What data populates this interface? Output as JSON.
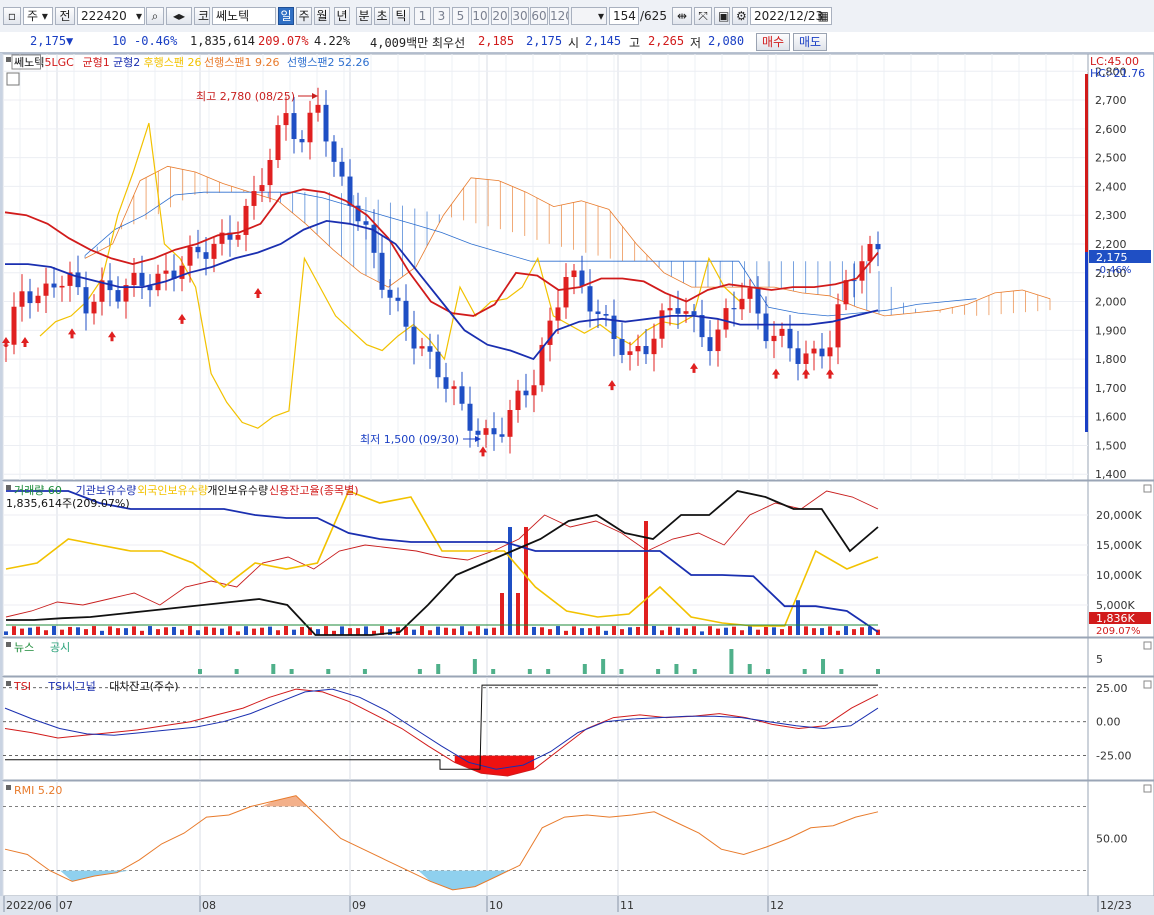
{
  "toolbar": {
    "market_type": "주",
    "prev_label": "전",
    "code": "222420",
    "exchange_label": "코",
    "stock_name": "쎄노텍",
    "periods": [
      "일",
      "주",
      "월",
      "년",
      "분",
      "초",
      "틱"
    ],
    "active_period": "일",
    "minute_numbers": [
      "1",
      "3",
      "5",
      "10",
      "20",
      "30",
      "60",
      "120"
    ],
    "count": "154",
    "total": "/625",
    "date": "2022/12/23"
  },
  "quote": {
    "price": "2,175",
    "direction": "▼",
    "change": "10",
    "change_pct": "-0.46%",
    "volume": "1,835,614",
    "volume_ratio": "209.07%",
    "turnover_rate": "4.22%",
    "amount": "4,009백만",
    "best_ask_label": "최우선",
    "best_ask": "2,185",
    "best_bid": "2,175",
    "open_label": "시",
    "open": "2,145",
    "high_label": "고",
    "high": "2,265",
    "low_label": "저",
    "low": "2,080",
    "buy_label": "매수",
    "sell_label": "매도"
  },
  "colors": {
    "up": "#e02020",
    "down": "#1f4fc4",
    "ma_short": "#d11b1b",
    "ma_long": "#1a2fb0",
    "lagging": "#f2c200",
    "cloud_up": "#e87b2c",
    "cloud_down": "#2d6fcf",
    "panel_bg": "#ffffff",
    "axis_bg": "#ffffff"
  },
  "chart_data": [
    {
      "type": "candlestick",
      "title": "",
      "legend": [
        {
          "name": "쎄노텍",
          "color": "#111111"
        },
        {
          "name": "5LGC",
          "color": "#d11b1b"
        },
        {
          "name": "균형1",
          "color": "#d11b1b"
        },
        {
          "name": "균형2",
          "color": "#1a2fb0"
        },
        {
          "name": "후행스팬 26",
          "color": "#f2c200"
        },
        {
          "name": "선행스팬1 9.26",
          "color": "#e87b2c"
        },
        {
          "name": "선행스팬2 52.26",
          "color": "#2d6fcf"
        }
      ],
      "ylim": [
        1380,
        2860
      ],
      "yticks": [
        "2,800",
        "2,700",
        "2,600",
        "2,500",
        "2,400",
        "2,300",
        "2,200",
        "2,100",
        "2,000",
        "1,900",
        "1,800",
        "1,700",
        "1,600",
        "1,500",
        "1,400"
      ],
      "x_labels": [
        "2022/06",
        "07",
        "08",
        "09",
        "10",
        "11",
        "12",
        "12/23"
      ],
      "annotations": {
        "high": "최고 2,780 (08/25)",
        "low": "최저 1,500 (09/30)",
        "lc": "LC:45.00",
        "hc": "HC:-21.76",
        "current": "2,175",
        "current_pct": "-0.46%"
      },
      "ohlc_anchor_closes": [
        1850,
        2050,
        2000,
        2080,
        2070,
        1980,
        2050,
        2030,
        2080,
        2060,
        2100,
        2150,
        2180,
        2200,
        2250,
        2350,
        2500,
        2650,
        2550,
        2700,
        2450,
        2350,
        2220,
        2050,
        1950,
        1850,
        1780,
        1700,
        1600,
        1520,
        1550,
        1650,
        1720,
        1900,
        2100,
        2050,
        1950,
        1880,
        1800,
        1850,
        1950,
        2000,
        1900,
        1850,
        1980,
        2050,
        1900,
        1880,
        1820,
        1800,
        1850,
        2050,
        2150,
        2180
      ],
      "ma_short": [
        2310,
        2300,
        2270,
        2220,
        2180,
        2150,
        2130,
        2150,
        2180,
        2200,
        2230,
        2240,
        2270,
        2370,
        2390,
        2380,
        2350,
        2300,
        2220,
        2100,
        2000,
        1960,
        1950,
        1990,
        2100,
        2090,
        2040,
        2050,
        2080,
        2080,
        2070,
        2030,
        2000,
        2040,
        2060,
        2050,
        2040,
        2050,
        2050,
        2060,
        2080,
        2170
      ],
      "ma_long": [
        2130,
        2130,
        2120,
        2090,
        2070,
        2050,
        2050,
        2070,
        2100,
        2120,
        2150,
        2170,
        2200,
        2250,
        2280,
        2270,
        2250,
        2200,
        2100,
        2000,
        1900,
        1850,
        1830,
        1800,
        1900,
        1930,
        1940,
        1930,
        1940,
        1950,
        1950,
        1940,
        1920,
        1920,
        1920,
        1920,
        1930,
        1950,
        1970
      ],
      "lagging_span": [
        1880,
        1930,
        1950,
        2000,
        2080,
        2300,
        2450,
        2620,
        2200,
        2150,
        2050,
        1750,
        1650,
        1580,
        1560,
        1600,
        1620,
        2150,
        2050,
        1950,
        1900,
        1850,
        1830,
        1880,
        1920,
        1870,
        1800,
        2050,
        1950,
        2000,
        2010,
        2050,
        2150,
        1950,
        1920,
        1890,
        1920,
        1880,
        1850,
        1900,
        1930,
        1920,
        1950,
        2150,
        2050,
        2000
      ],
      "senkou_1": [
        2150,
        2200,
        2420,
        2470,
        2450,
        2410,
        2380,
        2350,
        2270,
        2180,
        2100,
        2050,
        2120,
        2300,
        2430,
        2420,
        2380,
        2330,
        2350,
        2320,
        2200,
        2100,
        2050,
        2050,
        2050,
        2050,
        2030,
        2020,
        1980,
        1950,
        1960,
        1970,
        1990,
        2030,
        2040,
        2010
      ],
      "senkou_2": [
        2160,
        2250,
        2300,
        2370,
        2380,
        2380,
        2380,
        2380,
        2360,
        2330,
        2300,
        2270,
        2240,
        2200,
        2170,
        2140,
        2140,
        2140,
        2140,
        2140,
        2140,
        2140,
        2140,
        1980,
        1960,
        1950,
        1960,
        1970,
        1990,
        2000,
        2010
      ]
    },
    {
      "type": "bar",
      "title": "",
      "legend": [
        {
          "name": "거래량 60",
          "color": "#1c8a38"
        },
        {
          "name": "기관보유수량",
          "color": "#1a2fb0"
        },
        {
          "name": "외국인보유수량",
          "color": "#f2c200"
        },
        {
          "name": "개인보유수량",
          "color": "#111111"
        },
        {
          "name": "신용잔고율(종목별)",
          "color": "#d11b1b"
        }
      ],
      "volume_label": "1,835,614주(209.07%)",
      "yticks": [
        "20,000K",
        "15,000K",
        "10,000K",
        "5,000K"
      ],
      "ylim": [
        0,
        25000
      ],
      "current": "1,836K",
      "current_pct": "209.07%",
      "institution": [
        24000,
        24000,
        24000,
        22000,
        21000,
        21000,
        21000,
        21000,
        20000,
        19500,
        19500,
        17000,
        16000,
        15500,
        15500,
        15500,
        15500,
        14000,
        14000,
        14000,
        14000,
        14000,
        10000,
        10000,
        9800,
        4800,
        4800,
        4000,
        500
      ],
      "foreign": [
        11000,
        12000,
        16000,
        15000,
        14000,
        14000,
        12000,
        8000,
        12000,
        11000,
        12000,
        24000,
        22000,
        23000,
        14000,
        14000,
        14000,
        8000,
        4000,
        3000,
        3500,
        8000,
        3000,
        2000,
        1500,
        1500,
        14000,
        11000,
        13000
      ],
      "individual": [
        2500,
        2500,
        2800,
        3000,
        3500,
        4000,
        4500,
        5000,
        5500,
        6000,
        5000,
        0,
        0,
        0,
        500,
        5000,
        10000,
        12000,
        14000,
        16000,
        19000,
        20000,
        17000,
        16000,
        20000,
        20000,
        24000,
        23000,
        21000,
        21000,
        14000,
        18000
      ],
      "credit_ratio": [
        3000,
        4000,
        5500,
        5000,
        6000,
        7000,
        5000,
        8000,
        9000,
        8000,
        12000,
        13000,
        11000,
        14000,
        15000,
        14500,
        14000,
        13000,
        12500,
        14000,
        16000,
        20000,
        18000,
        19000,
        17000,
        14000,
        16000,
        17000,
        15000,
        20000,
        22000,
        21000,
        24000,
        23000,
        21000
      ]
    },
    {
      "type": "bar",
      "title": "",
      "legend": [
        {
          "name": "뉴스",
          "color": "#1c8a38"
        },
        {
          "name": "공시",
          "color": "#2aa37a"
        }
      ],
      "yticks": [
        "5"
      ],
      "values": [
        1,
        0,
        1,
        0,
        2,
        1,
        0,
        1,
        0,
        1,
        0,
        0,
        1,
        2,
        0,
        3,
        1,
        0,
        1,
        1,
        0,
        2,
        3,
        1,
        0,
        1,
        2,
        1,
        0,
        5,
        2,
        1,
        0,
        1,
        3,
        1,
        0,
        1
      ]
    },
    {
      "type": "line",
      "title": "",
      "legend": [
        {
          "name": "TSI",
          "color": "#d11b1b"
        },
        {
          "name": "TSI시그널",
          "color": "#1a2fb0"
        },
        {
          "name": "대차잔고(주수)",
          "color": "#111111"
        }
      ],
      "yticks": [
        "25.00",
        "0.00",
        "-25.00"
      ],
      "ylim": [
        -40,
        30
      ],
      "tsi": [
        -5,
        -8,
        -12,
        -10,
        -8,
        -6,
        -3,
        0,
        5,
        10,
        18,
        24,
        22,
        15,
        5,
        -5,
        -18,
        -30,
        -38,
        -40,
        -35,
        -20,
        -5,
        3,
        5,
        3,
        4,
        6,
        3,
        -2,
        -5,
        -3,
        10,
        20
      ],
      "tsi_signal": [
        10,
        2,
        -5,
        -9,
        -10,
        -8,
        -6,
        -4,
        0,
        6,
        14,
        22,
        24,
        18,
        8,
        -5,
        -18,
        -30,
        -35,
        -32,
        -22,
        -8,
        0,
        2,
        3,
        4,
        4,
        3,
        0,
        -3,
        -5,
        -3,
        10
      ],
      "lending_balance": [
        -28,
        -28,
        -28,
        -28,
        -28,
        -28,
        -28,
        -28,
        -35,
        -35,
        25,
        25,
        25,
        25,
        25,
        25,
        25,
        25,
        25,
        25,
        25
      ]
    },
    {
      "type": "area",
      "title": "",
      "legend": [
        {
          "name": "RMI 5.20",
          "color": "#e87b2c"
        }
      ],
      "yticks": [
        "50.00"
      ],
      "ylim": [
        0,
        100
      ],
      "upper_band": 80,
      "lower_band": 20,
      "values": [
        40,
        35,
        20,
        10,
        15,
        18,
        30,
        45,
        55,
        70,
        72,
        80,
        85,
        90,
        70,
        50,
        40,
        30,
        20,
        10,
        2,
        5,
        15,
        25,
        60,
        70,
        72,
        70,
        72,
        75,
        65,
        55,
        40,
        35,
        42,
        50,
        60,
        62,
        70,
        75
      ]
    }
  ]
}
